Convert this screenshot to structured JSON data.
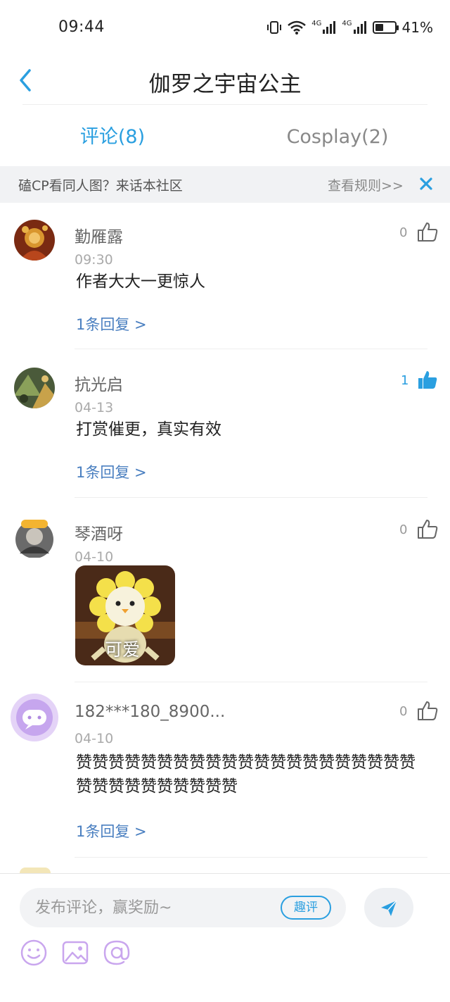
{
  "status_bar": {
    "time": "09:44",
    "signal_1": "4G",
    "signal_2": "4G",
    "battery_percent": "41%",
    "battery_level": 0.41
  },
  "header": {
    "title": "伽罗之宇宙公主",
    "back_icon": "chevron-left-icon"
  },
  "tabs": [
    {
      "label": "评论(8)",
      "active": true
    },
    {
      "label": "Cosplay(2)",
      "active": false
    }
  ],
  "banner": {
    "text": "磕CP看同人图？来话本社区",
    "rules": "查看规则>>",
    "close_icon": "close-icon"
  },
  "comments": [
    {
      "name": "勤雁露",
      "time": "09:30",
      "text": "作者大大一更惊人",
      "likes": "0",
      "liked": false,
      "reply": "1条回复 >"
    },
    {
      "name": "抗光启",
      "time": "04-13",
      "text": "打赏催更，真实有效",
      "likes": "1",
      "liked": true,
      "reply": "1条回复 >"
    },
    {
      "name": "琴酒呀",
      "time": "04-10",
      "sticker_caption": "可爱",
      "likes": "0",
      "liked": false
    },
    {
      "name": "182***180_8900...",
      "time": "04-10",
      "text": "赞赞赞赞赞赞赞赞赞赞赞赞赞赞赞赞赞赞赞赞赞赞赞赞赞赞赞赞赞赞赞",
      "likes": "0",
      "liked": false,
      "reply": "1条回复 >"
    }
  ],
  "composer": {
    "placeholder": "发布评论，赢奖励~",
    "quping_label": "趣评",
    "send_icon": "send-icon",
    "tools": [
      "emoji-icon",
      "image-icon",
      "at-icon"
    ]
  },
  "colors": {
    "accent": "#2a9fe0",
    "link": "#4a7fc0",
    "banner_bg": "#f1f2f4"
  }
}
